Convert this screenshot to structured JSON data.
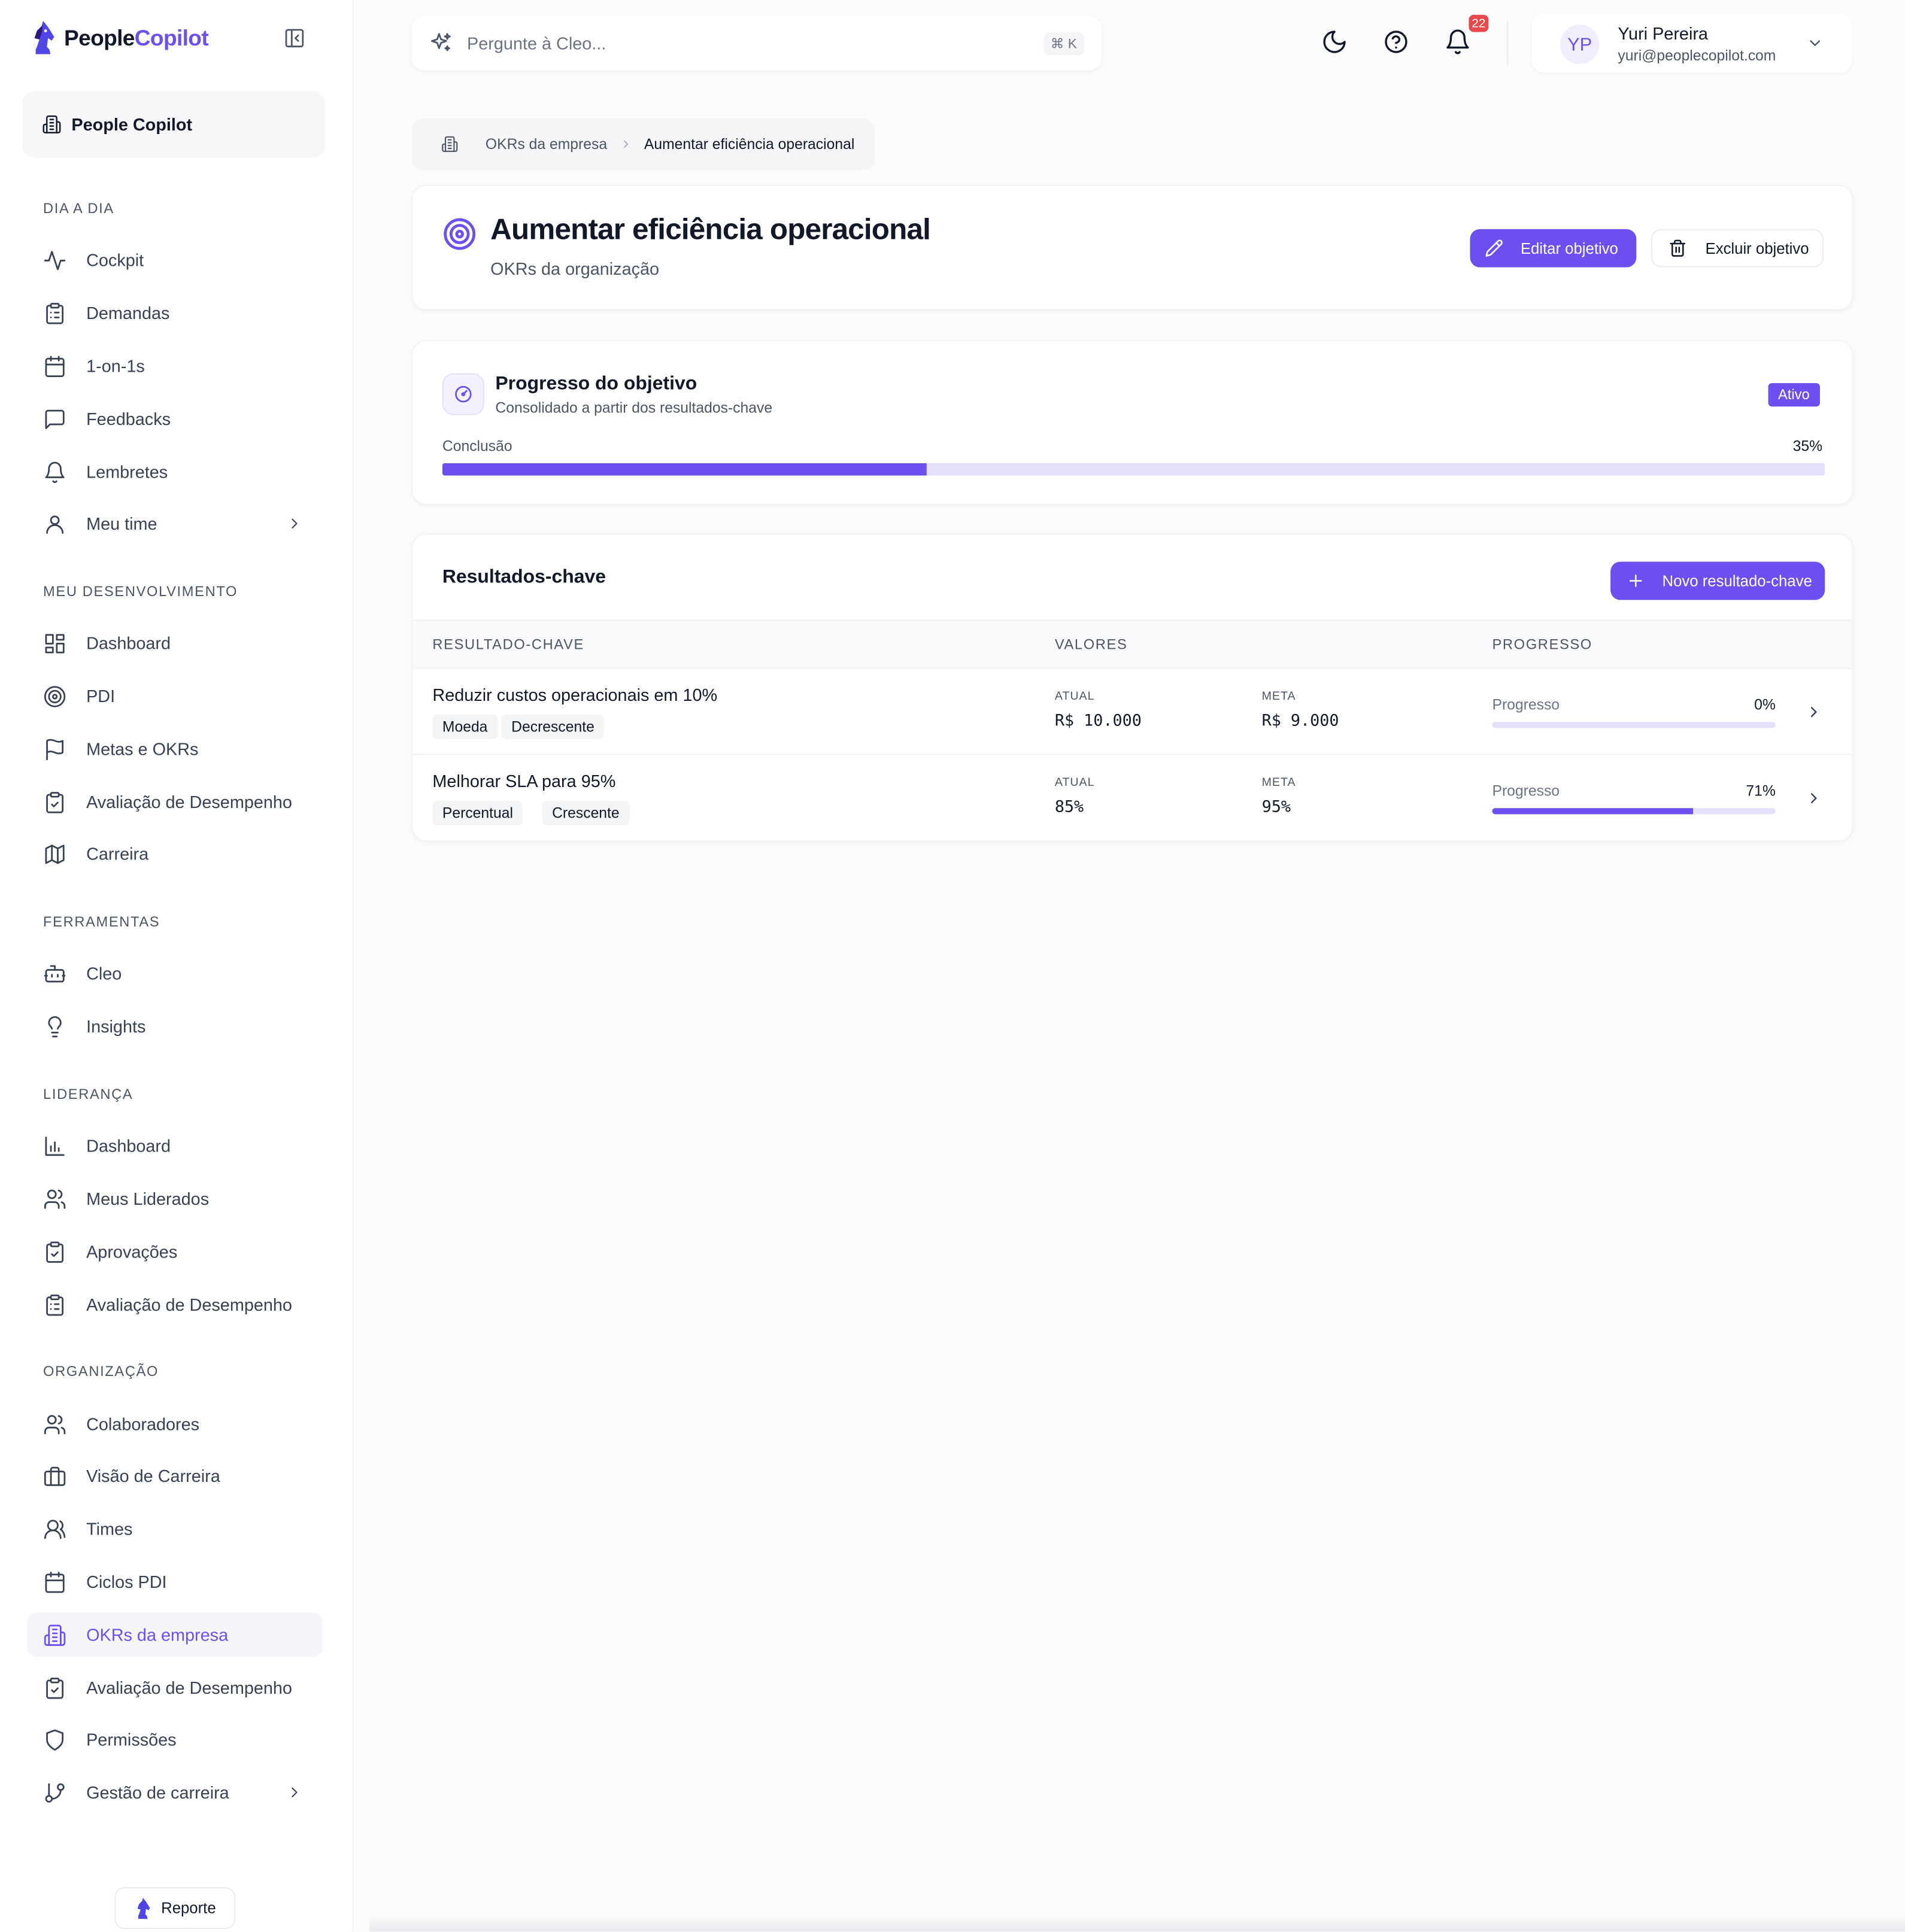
{
  "brand": {
    "name_part1": "People",
    "name_part2": "Copilot",
    "accent": "#6d4ff0"
  },
  "org": {
    "name": "People Copilot"
  },
  "sidebar": {
    "sections": [
      {
        "title": "DIA A DIA",
        "items": [
          {
            "label": "Cockpit",
            "icon": "activity-icon"
          },
          {
            "label": "Demandas",
            "icon": "clipboard-list-icon"
          },
          {
            "label": "1-on-1s",
            "icon": "calendar-icon"
          },
          {
            "label": "Feedbacks",
            "icon": "message-square-icon"
          },
          {
            "label": "Lembretes",
            "icon": "bell-icon"
          },
          {
            "label": "Meu time",
            "icon": "user-icon",
            "has_submenu": true
          }
        ]
      },
      {
        "title": "MEU DESENVOLVIMENTO",
        "items": [
          {
            "label": "Dashboard",
            "icon": "layout-dashboard-icon"
          },
          {
            "label": "PDI",
            "icon": "target-icon"
          },
          {
            "label": "Metas e OKRs",
            "icon": "flag-icon"
          },
          {
            "label": "Avaliação de Desempenho",
            "icon": "clipboard-check-icon"
          },
          {
            "label": "Carreira",
            "icon": "map-icon"
          }
        ]
      },
      {
        "title": "FERRAMENTAS",
        "items": [
          {
            "label": "Cleo",
            "icon": "bot-icon"
          },
          {
            "label": "Insights",
            "icon": "lightbulb-icon"
          }
        ]
      },
      {
        "title": "LIDERANÇA",
        "items": [
          {
            "label": "Dashboard",
            "icon": "bar-chart-icon"
          },
          {
            "label": "Meus Liderados",
            "icon": "users-icon"
          },
          {
            "label": "Aprovações",
            "icon": "clipboard-check-icon"
          },
          {
            "label": "Avaliação de Desempenho",
            "icon": "clipboard-list-icon"
          }
        ]
      },
      {
        "title": "ORGANIZAÇÃO",
        "items": [
          {
            "label": "Colaboradores",
            "icon": "users-icon"
          },
          {
            "label": "Visão de Carreira",
            "icon": "briefcase-icon"
          },
          {
            "label": "Times",
            "icon": "users-round-icon"
          },
          {
            "label": "Ciclos PDI",
            "icon": "calendar-icon"
          },
          {
            "label": "OKRs da empresa",
            "icon": "building-icon",
            "active": true
          },
          {
            "label": "Avaliação de Desempenho",
            "icon": "clipboard-check-icon"
          },
          {
            "label": "Permissões",
            "icon": "shield-icon"
          },
          {
            "label": "Gestão de carreira",
            "icon": "git-branch-icon",
            "has_submenu": true
          }
        ]
      }
    ],
    "report_label": "Reporte"
  },
  "topbar": {
    "search_placeholder": "Pergunte à Cleo...",
    "shortcut": "⌘ K",
    "notifications_count": "22",
    "user": {
      "initials": "YP",
      "name": "Yuri Pereira",
      "email": "yuri@peoplecopilot.com"
    }
  },
  "breadcrumb": {
    "parent": "OKRs da empresa",
    "current": "Aumentar eficiência operacional"
  },
  "objective": {
    "title": "Aumentar eficiência operacional",
    "subtitle": "OKRs da organização",
    "edit_label": "Editar objetivo",
    "delete_label": "Excluir objetivo"
  },
  "progress": {
    "title": "Progresso do objetivo",
    "subtitle": "Consolidado a partir dos resultados-chave",
    "status": "Ativo",
    "label": "Conclusão",
    "value_text": "35%",
    "value": 35
  },
  "key_results": {
    "title": "Resultados-chave",
    "add_label": "Novo resultado-chave",
    "columns": [
      "RESULTADO-CHAVE",
      "VALORES",
      "PROGRESSO"
    ],
    "current_label": "ATUAL",
    "target_label": "META",
    "progress_label": "Progresso",
    "rows": [
      {
        "name": "Reduzir custos operacionais em 10%",
        "tags": [
          "Moeda",
          "Decrescente"
        ],
        "current": "R$ 10.000",
        "target": "R$ 9.000",
        "progress_text": "0%",
        "progress": 0
      },
      {
        "name": "Melhorar SLA para 95%",
        "tags": [
          "Percentual",
          "Crescente"
        ],
        "current": "85%",
        "target": "95%",
        "progress_text": "71%",
        "progress": 71
      }
    ]
  }
}
